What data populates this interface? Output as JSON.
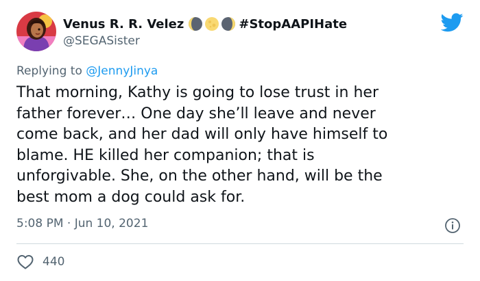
{
  "colors": {
    "text": "#0f1419",
    "secondary": "#536471",
    "accent_blue": "#1d9bf0",
    "divider": "#cfd9de"
  },
  "author": {
    "display_name": "Venus R. R. Velez",
    "hashtag": "#StopAAPIHate",
    "handle": "@SEGASister",
    "avatar": "avatar",
    "name_emojis": [
      "waning-moon-emoji",
      "full-moon-emoji",
      "waxing-moon-emoji"
    ]
  },
  "reply": {
    "prefix": "Replying to ",
    "mention": "@JennyJinya"
  },
  "tweet": {
    "text": "That morning, Kathy is going to lose trust in her\nfather forever… One day she’ll leave and never\ncome back, and her dad will only have himself to\nblame. HE killed her companion; that is\nunforgivable. She, on the other hand, will be the\nbest mom a dog could ask for.",
    "timestamp": "5:08 PM · Jun 10, 2021"
  },
  "engagement": {
    "likes": "440"
  },
  "icons": {
    "brand": "twitter-bird-icon",
    "info": "info-icon",
    "like": "heart-icon"
  }
}
